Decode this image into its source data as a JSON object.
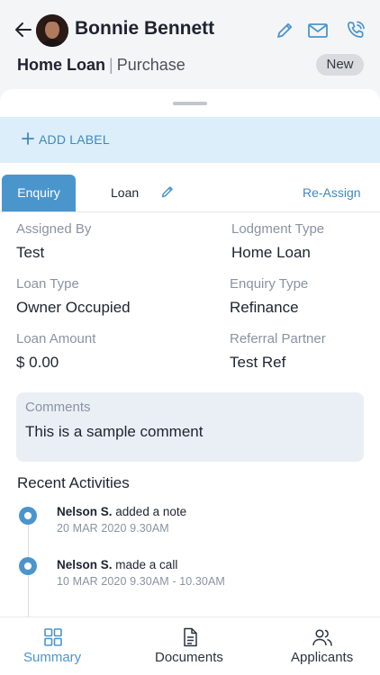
{
  "header": {
    "contact_name": "Bonnie Bennett",
    "loan_title": "Home Loan",
    "separator": "|",
    "loan_purpose": "Purchase",
    "status_badge": "New"
  },
  "label_bar": {
    "add_label": "ADD LABEL"
  },
  "tabs": {
    "enquiry": "Enquiry",
    "loan": "Loan",
    "reassign": "Re-Assign"
  },
  "details": {
    "assigned_by": {
      "label": "Assigned By",
      "value": "Test"
    },
    "lodgment_type": {
      "label": "Lodgment Type",
      "value": "Home Loan"
    },
    "loan_type": {
      "label": "Loan Type",
      "value": "Owner Occupied"
    },
    "enquiry_type": {
      "label": "Enquiry Type",
      "value": "Refinance"
    },
    "loan_amount": {
      "label": "Loan Amount",
      "value": "$ 0.00"
    },
    "referral_partner": {
      "label": "Referral Partner",
      "value": "Test Ref"
    }
  },
  "comments": {
    "label": "Comments",
    "value": "This is a sample comment"
  },
  "recent_activities": {
    "title": "Recent Activities",
    "items": [
      {
        "actor": "Nelson S.",
        "action": "added a note",
        "when": "20 MAR 2020  9.30AM"
      },
      {
        "actor": "Nelson S.",
        "action": "made a call",
        "when": "10 MAR 2020  9.30AM - 10.30AM"
      }
    ]
  },
  "bottom_nav": {
    "summary": "Summary",
    "documents": "Documents",
    "applicants": "Applicants"
  },
  "colors": {
    "accent": "#4b95cd",
    "label_bar_bg": "#dbeef9",
    "header_bg": "#f4f5f7"
  }
}
